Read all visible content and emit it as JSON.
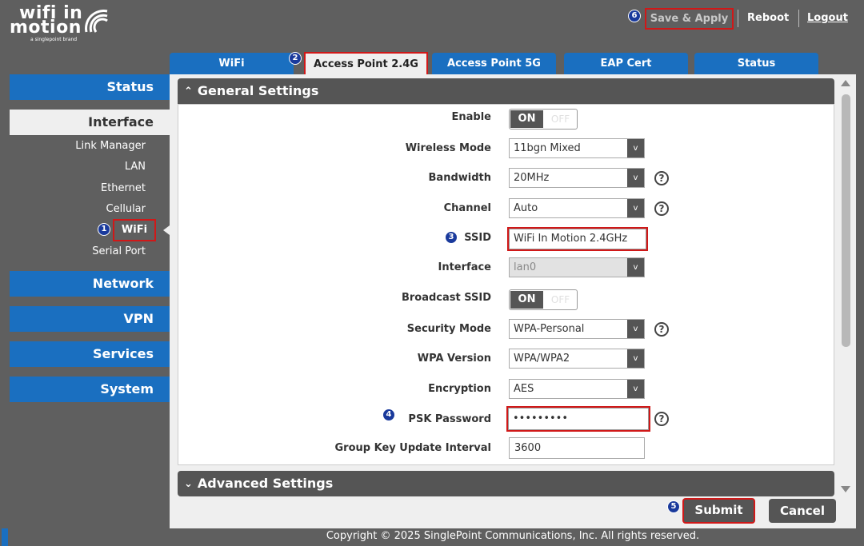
{
  "brand": {
    "line1": "wifi in",
    "line2": "motion",
    "tagline": "a singlepoint brand"
  },
  "header": {
    "save_apply": "Save & Apply",
    "reboot": "Reboot",
    "logout": "Logout"
  },
  "markers": [
    "1",
    "2",
    "3",
    "4",
    "5",
    "6"
  ],
  "tabs": [
    {
      "label": "WiFi"
    },
    {
      "label": "Access Point 2.4G"
    },
    {
      "label": "Access Point 5G"
    },
    {
      "label": "EAP Cert"
    },
    {
      "label": "Status"
    }
  ],
  "sidebar": {
    "status": "Status",
    "interface": "Interface",
    "items": [
      "Link Manager",
      "LAN",
      "Ethernet",
      "Cellular",
      "WiFi",
      "Serial Port"
    ],
    "network": "Network",
    "vpn": "VPN",
    "services": "Services",
    "system": "System"
  },
  "general": {
    "title": "General Settings",
    "enable": {
      "label": "Enable",
      "on": "ON",
      "off": "OFF"
    },
    "wireless_mode": {
      "label": "Wireless Mode",
      "value": "11bgn Mixed"
    },
    "bandwidth": {
      "label": "Bandwidth",
      "value": "20MHz"
    },
    "channel": {
      "label": "Channel",
      "value": "Auto"
    },
    "ssid": {
      "label": "SSID",
      "value": "WiFi In Motion 2.4GHz"
    },
    "interface": {
      "label": "Interface",
      "value": "lan0"
    },
    "broadcast_ssid": {
      "label": "Broadcast SSID",
      "on": "ON",
      "off": "OFF"
    },
    "security_mode": {
      "label": "Security Mode",
      "value": "WPA-Personal"
    },
    "wpa_version": {
      "label": "WPA Version",
      "value": "WPA/WPA2"
    },
    "encryption": {
      "label": "Encryption",
      "value": "AES"
    },
    "psk_password": {
      "label": "PSK Password",
      "value": "•••••••••"
    },
    "group_key": {
      "label": "Group Key Update Interval",
      "value": "3600"
    }
  },
  "advanced": {
    "title": "Advanced Settings"
  },
  "buttons": {
    "submit": "Submit",
    "cancel": "Cancel"
  },
  "footer": "Copyright © 2025 SinglePoint Communications, Inc. All rights reserved."
}
